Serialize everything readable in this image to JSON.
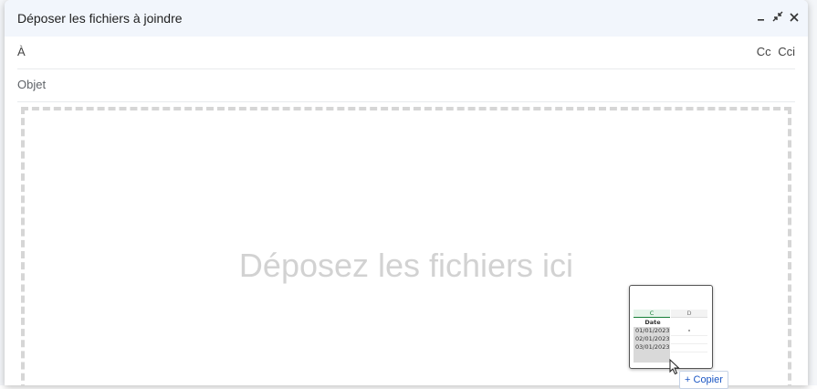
{
  "window": {
    "title": "Déposer les fichiers à joindre",
    "minimize_icon": "minimize-icon",
    "exit_fullscreen_icon": "exit-fullscreen-icon",
    "close_icon": "close-icon"
  },
  "recipients": {
    "to_label": "À",
    "to_value": "",
    "cc_label": "Cc",
    "bcc_label": "Cci"
  },
  "subject": {
    "placeholder": "Objet",
    "value": ""
  },
  "dropzone": {
    "text": "Déposez les fichiers ici"
  },
  "drag_preview": {
    "columns": [
      "C",
      "D"
    ],
    "header": "Date",
    "rows": [
      "01/01/2023",
      "02/01/2023",
      "03/01/2023"
    ]
  },
  "drag_action": {
    "icon": "plus-icon",
    "label": "Copier"
  },
  "colors": {
    "title_bar": "#f2f6fc",
    "dropzone_border": "#d6d6d6",
    "copy_label": "#1a56c4"
  }
}
